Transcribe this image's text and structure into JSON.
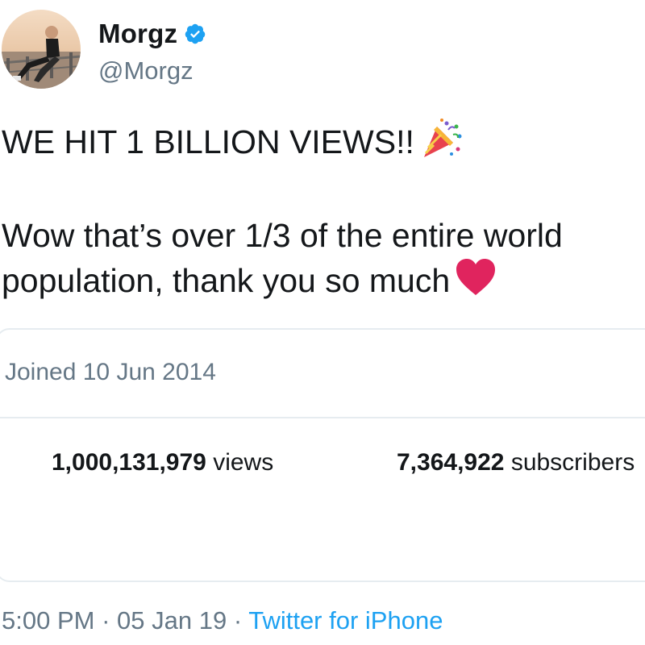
{
  "tweet": {
    "author": {
      "display_name": "Morgz",
      "handle": "@Morgz",
      "verified": true,
      "verified_icon": "verified-badge-icon"
    },
    "text_line_1": "WE HIT 1 BILLION VIEWS!!",
    "text_line_1_emoji": "party-popper-icon",
    "text_line_2": "Wow that’s over 1/3 of the entire world",
    "text_line_3": "population, thank you so much",
    "text_line_3_emoji": "red-heart-icon",
    "card": {
      "joined": "Joined 10 Jun 2014",
      "views_count": "1,000,131,979",
      "views_label": "views",
      "subscribers_count": "7,364,922",
      "subscribers_label": "subscribers"
    },
    "footer": {
      "time": "5:00 PM",
      "separator": "·",
      "date": "05 Jan 19",
      "source": "Twitter for iPhone"
    }
  },
  "colors": {
    "text_primary": "#14171a",
    "text_secondary": "#657786",
    "link_blue": "#1da1f2",
    "verified_blue": "#1da1f2",
    "border": "#e6ecf0",
    "heart_red": "#e0245e"
  }
}
